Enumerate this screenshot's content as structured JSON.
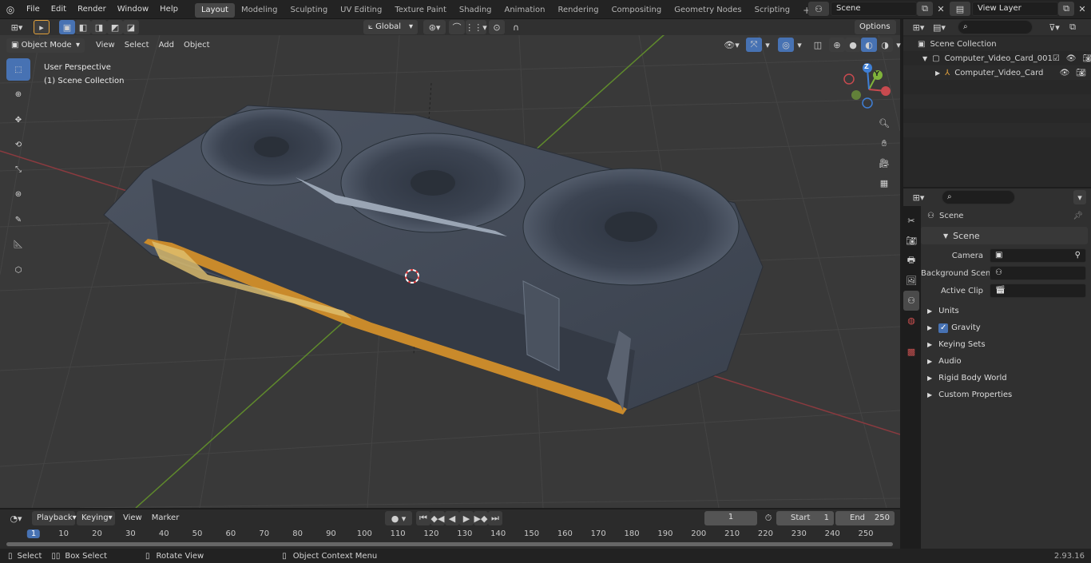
{
  "topbar": {
    "menus": [
      "File",
      "Edit",
      "Render",
      "Window",
      "Help"
    ],
    "workspaces": [
      "Layout",
      "Modeling",
      "Sculpting",
      "UV Editing",
      "Texture Paint",
      "Shading",
      "Animation",
      "Rendering",
      "Compositing",
      "Geometry Nodes",
      "Scripting"
    ],
    "active_workspace": "Layout",
    "add_tab": "+",
    "scene_name": "Scene",
    "view_layer": "View Layer"
  },
  "viewport_header": {
    "transform_orientation": "Global",
    "options_label": "Options",
    "mode": "Object Mode",
    "menus": [
      "View",
      "Select",
      "Add",
      "Object"
    ]
  },
  "viewport": {
    "perspective": "User Perspective",
    "collection": "(1) Scene Collection",
    "gizmo_labels": {
      "z": "Z",
      "y": "Y"
    }
  },
  "outliner": {
    "search_placeholder": "",
    "root": "Scene Collection",
    "collection": "Computer_Video_Card_001",
    "object": "Computer_Video_Card"
  },
  "properties": {
    "context": "Scene",
    "section": "Scene",
    "fields": [
      {
        "label": "Camera",
        "value": ""
      },
      {
        "label": "Background Scene",
        "value": ""
      },
      {
        "label": "Active Clip",
        "value": ""
      }
    ],
    "panels": [
      "Units",
      "Gravity",
      "Keying Sets",
      "Audio",
      "Rigid Body World",
      "Custom Properties"
    ],
    "gravity_checked": true
  },
  "timeline": {
    "menus": [
      "Playback",
      "Keying",
      "View",
      "Marker"
    ],
    "current_frame": "1",
    "start_label": "Start",
    "start_value": "1",
    "end_label": "End",
    "end_value": "250",
    "ruler": [
      "1",
      "10",
      "20",
      "30",
      "40",
      "50",
      "60",
      "70",
      "80",
      "90",
      "100",
      "110",
      "120",
      "130",
      "140",
      "150",
      "160",
      "170",
      "180",
      "190",
      "200",
      "210",
      "220",
      "230",
      "240",
      "250"
    ]
  },
  "statusbar": {
    "select": "Select",
    "box_select": "Box Select",
    "rotate_view": "Rotate View",
    "context_menu": "Object Context Menu",
    "version": "2.93.16"
  },
  "colors": {
    "accent": "#4772b3",
    "x_axis": "#c74a4f",
    "y_axis": "#7fb33a",
    "z_axis": "#3f7fd6"
  }
}
